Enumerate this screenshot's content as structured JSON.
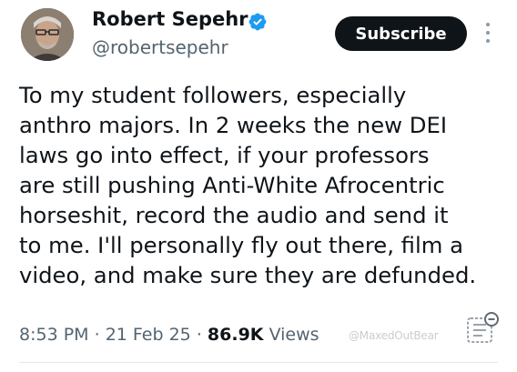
{
  "author": {
    "name": "Robert Sepehr",
    "handle": "@robertsepehr",
    "verified": true
  },
  "actions": {
    "subscribe_label": "Subscribe",
    "more_icon": "more-vertical-icon"
  },
  "tweet": {
    "lines": [
      "To my student followers, especially",
      "anthro majors. In 2 weeks the new DEI",
      "laws go into effect, if your professors",
      "are still pushing Anti-White Afrocentric",
      "horseshit, record the audio and send it",
      "to me. I'll personally fly out there, film a",
      "video, and make sure they are defunded."
    ]
  },
  "meta": {
    "time": "8:53 PM",
    "separator": "·",
    "date": "21 Feb 25",
    "views_count": "86.9K",
    "views_label": "Views"
  },
  "watermark": {
    "text": "@MaxedOutBear",
    "icon": "maxedoutbear-logo-icon"
  },
  "colors": {
    "text": "#0f1419",
    "secondary": "#536471",
    "verified": "#1d9bf0",
    "button_bg": "#0f1419"
  }
}
